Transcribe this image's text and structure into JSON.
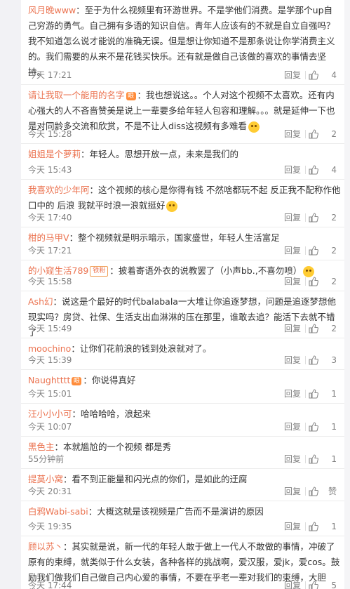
{
  "reply_label": "回复",
  "like_word": "赞",
  "colors": {
    "username": "#eb7350",
    "meta": "#808080",
    "text": "#333333"
  },
  "comments": [
    {
      "user": "风月晚www",
      "text": "：至于为什么视频里有环游世界。不是学他们消费。是学那个up自己穷游的勇气。自己拥有多语的知识自信。青年人应该有的不就是自立自强吗？我不知道怎么说才能说的准确无误。但是想让你知道不是那条说让你学消费主义的。我们需要的从来不是花钱买快乐。还有就是做自己该做的喜欢的事情去坚持。",
      "time": "今天 17:21",
      "likes": "4"
    },
    {
      "user": "请让我取一个能用的名字",
      "badge": "眼",
      "text": "：我也想说这。。个人对这个视频不太喜欢。还有内心强大的人不吝啬赞美是说上一辈要多给年轻人包容和理解。。。就是延伸一下也是对同龄多交流和欣赏，不是不让人diss这视频有多难看",
      "emoji": "sweat-smile-emoji",
      "time": "今天 15:28",
      "likes": "2"
    },
    {
      "user": "姐姐是个萝莉",
      "text": "：年轻人。思想开放一点，未来是我们的",
      "time": "今天 15:43",
      "likes": "4"
    },
    {
      "user": "我喜欢的少年阿",
      "text": "：这个视频的核心是你得有钱  不然啥都玩不起  反正我不配称作他口中的 后浪   我就平时浪一浪就挺好",
      "emoji": "cute-face-emoji",
      "time": "今天 17:40",
      "likes": "2"
    },
    {
      "user": "柑的马甲V",
      "text": "：整个视频就是明示暗示，国家盛世，年轻人生活富足",
      "time": "今天 17:21",
      "likes": "2"
    },
    {
      "user": "的小窥生活789",
      "vip": "铁粉",
      "text": "：披着寄语外衣的说教罢了（小声bb.,不喜勿喷）",
      "emoji": "laugh-emoji",
      "time": "今天 15:58",
      "likes": "2"
    },
    {
      "user": "Ash幻",
      "text": "：说这是个最好的时代balabala一大堆让你追逐梦想，问题是追逐梦想他现实吗？房贷、社保、生活支出血淋淋的压在那里，谁敢去追？能活下去就不错了",
      "time": "今天 15:49",
      "likes": "2"
    },
    {
      "user": "moochino",
      "text": "：让你们花前浪的钱到处浪就对了。",
      "time": "今天 15:39",
      "likes": "3"
    },
    {
      "user": "Naughtttt",
      "badge": "眼",
      "text": "：你说得真好",
      "time": "今天 15:01",
      "likes": "1"
    },
    {
      "user": "汪小小小可",
      "text": "：哈哈哈哈，浪起来",
      "time": "今天 10:07",
      "likes": "1"
    },
    {
      "user": "黑色主",
      "text": "：本就尴尬的一个视频 都是秀",
      "time": "55分钟前",
      "likes": "1"
    },
    {
      "user": "提莫小窝",
      "text": "：看不到正能量和闪光点的你们，是如此的迂腐",
      "time": "今天 20:31",
      "likes": ""
    },
    {
      "user": "白鸦Wabi-sabi",
      "text": "：大概这就是该视频是广告而不是演讲的原因",
      "time": "今天 19:35",
      "likes": "1"
    },
    {
      "user": "顾以苏丶",
      "text": "：其实就是说，新一代的年轻人敢于做上一代人不敢做的事情，冲破了原有的束缚，就类似于什么女装，各种各样的挑战啊，爱汉服，爱jk，爱cos。鼓励我们做我们自己做自己内心爱的事情，不要在乎老一辈对我们的束缚，大胆做。",
      "time": "今天 17:44",
      "likes": "5"
    }
  ]
}
